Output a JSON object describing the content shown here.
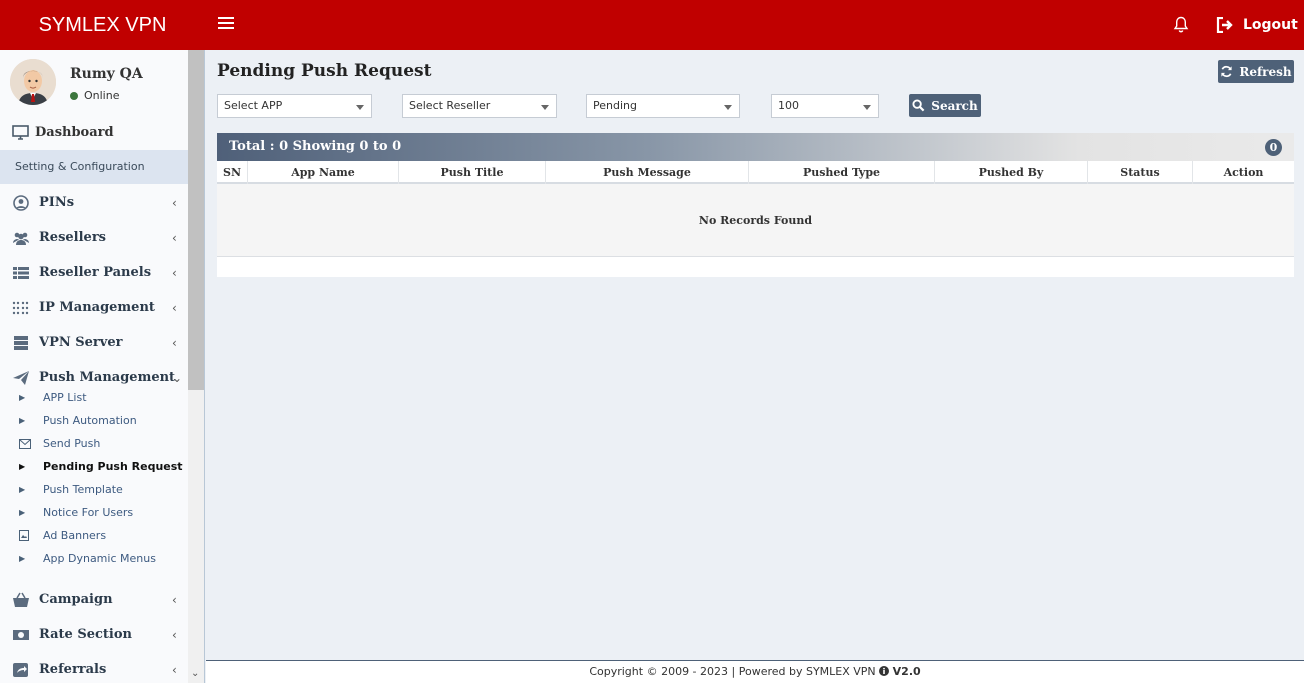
{
  "header": {
    "brand": "SYMLEX VPN",
    "logout_label": "Logout",
    "colors": {
      "bar": "#c00000"
    }
  },
  "user": {
    "name": "Rumy QA",
    "status": "Online"
  },
  "sidebar": {
    "dashboard": "Dashboard",
    "section": "Setting & Configuration",
    "items": [
      {
        "label": "PINs",
        "icon": "user-circle-icon"
      },
      {
        "label": "Resellers",
        "icon": "users-icon"
      },
      {
        "label": "Reseller Panels",
        "icon": "list-icon"
      },
      {
        "label": "IP Management",
        "icon": "ip-grid-icon"
      },
      {
        "label": "VPN Server",
        "icon": "server-icon"
      },
      {
        "label": "Push Management",
        "icon": "paper-plane-icon"
      }
    ],
    "push_sub": [
      {
        "label": "APP List",
        "icon": "caret-right-icon"
      },
      {
        "label": "Push Automation",
        "icon": "caret-right-icon"
      },
      {
        "label": "Send Push",
        "icon": "envelope-icon"
      },
      {
        "label": "Pending Push Request",
        "icon": "caret-right-icon"
      },
      {
        "label": "Push Template",
        "icon": "caret-right-icon"
      },
      {
        "label": "Notice For Users",
        "icon": "caret-right-icon"
      },
      {
        "label": "Ad Banners",
        "icon": "image-icon"
      },
      {
        "label": "App Dynamic Menus",
        "icon": "caret-right-icon"
      }
    ],
    "items_after": [
      {
        "label": "Campaign",
        "icon": "basket-icon"
      },
      {
        "label": "Rate Section",
        "icon": "money-icon"
      },
      {
        "label": "Referrals",
        "icon": "share-icon"
      }
    ]
  },
  "main": {
    "title": "Pending Push Request",
    "refresh_label": "Refresh",
    "filters": {
      "app": "Select APP",
      "reseller": "Select Reseller",
      "status": "Pending",
      "limit": "100"
    },
    "search_label": "Search",
    "total_text": "Total : 0 Showing 0 to 0",
    "total_badge": "0",
    "columns": [
      "SN",
      "App Name",
      "Push Title",
      "Push Message",
      "Pushed Type",
      "Pushed By",
      "Status",
      "Action"
    ],
    "empty_text": "No Records Found"
  },
  "footer": {
    "text": "Copyright © 2009 - 2023 | Powered by SYMLEX VPN",
    "version": "V2.0"
  }
}
